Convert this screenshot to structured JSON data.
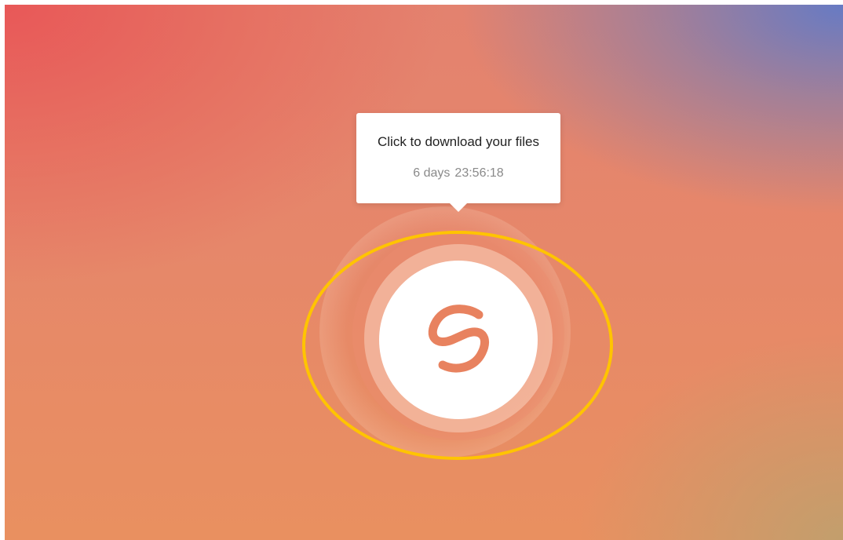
{
  "tooltip": {
    "title": "Click to download your files",
    "timer_days": "6 days",
    "timer_time": "23:56:18"
  },
  "download_button": {
    "icon": "smash-logo-icon",
    "icon_color": "#e8825f"
  },
  "highlight": {
    "color": "#ffc400"
  },
  "background": {
    "colors": [
      "#e85858",
      "#e6876a",
      "#607ac8",
      "#c8a070"
    ]
  }
}
